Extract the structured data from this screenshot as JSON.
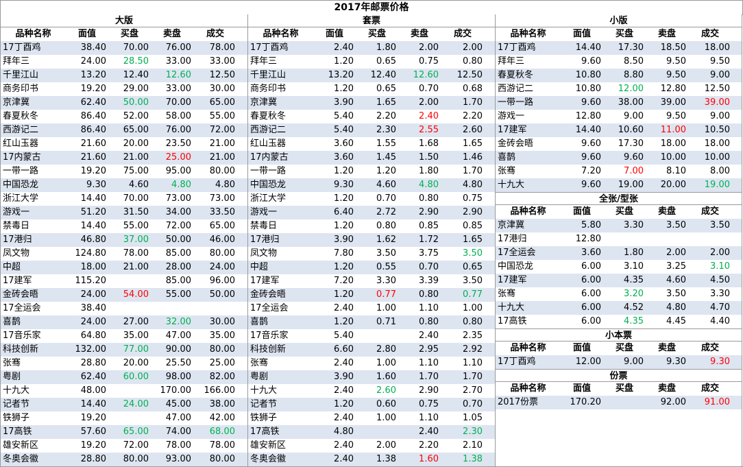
{
  "title": "2017年邮票价格",
  "colors": {
    "up": "#ff0000",
    "down": "#00b050",
    "stripe": "#dde5f1"
  },
  "columns": [
    "品种名称",
    "面值",
    "买盘",
    "卖盘",
    "成交"
  ],
  "panels": [
    {
      "title": "大版",
      "rows": [
        [
          "17丁酉鸡",
          "38.40",
          "70.00",
          "76.00",
          "78.00"
        ],
        [
          "拜年三",
          "24.00",
          "28.50",
          "33.00",
          "33.00"
        ],
        [
          "千里江山",
          "13.20",
          "12.40",
          "12.60",
          "12.50"
        ],
        [
          "商务印书",
          "19.20",
          "29.00",
          "33.00",
          "30.00"
        ],
        [
          "京津冀",
          "62.40",
          "50.00",
          "70.00",
          "65.00"
        ],
        [
          "春夏秋冬",
          "86.40",
          "52.00",
          "58.00",
          "55.00"
        ],
        [
          "西游记二",
          "86.40",
          "65.00",
          "76.00",
          "72.00"
        ],
        [
          "红山玉器",
          "21.60",
          "20.00",
          "23.50",
          "21.00"
        ],
        [
          "17内蒙古",
          "21.60",
          "21.00",
          "25.00",
          "21.00"
        ],
        [
          "一带一路",
          "19.20",
          "75.00",
          "95.00",
          "80.00"
        ],
        [
          "中国恐龙",
          "9.30",
          "4.60",
          "4.80",
          "4.80"
        ],
        [
          "浙江大学",
          "14.40",
          "70.00",
          "73.00",
          "73.00"
        ],
        [
          "游戏一",
          "51.20",
          "31.50",
          "34.00",
          "33.50"
        ],
        [
          "禁毒日",
          "14.40",
          "55.00",
          "72.00",
          "65.00"
        ],
        [
          "17港归",
          "46.80",
          "37.00",
          "50.00",
          "46.00"
        ],
        [
          "凤文物",
          "124.80",
          "78.00",
          "85.00",
          "80.00"
        ],
        [
          "中超",
          "18.00",
          "21.00",
          "28.00",
          "24.00"
        ],
        [
          "17建军",
          "115.20",
          "",
          "85.00",
          "96.00"
        ],
        [
          "金砖会晤",
          "24.00",
          "54.00",
          "55.00",
          "50.00"
        ],
        [
          "17全运会",
          "38.40",
          "",
          "",
          ""
        ],
        [
          "喜鹊",
          "24.00",
          "27.00",
          "32.00",
          "30.00"
        ],
        [
          "17音乐家",
          "64.80",
          "35.00",
          "47.00",
          "35.00"
        ],
        [
          "科技创新",
          "132.00",
          "77.00",
          "90.00",
          "80.00"
        ],
        [
          "张骞",
          "28.80",
          "20.00",
          "25.50",
          "25.00"
        ],
        [
          "粤剧",
          "62.40",
          "60.00",
          "98.00",
          "82.00"
        ],
        [
          "十九大",
          "48.00",
          "",
          "170.00",
          "166.00"
        ],
        [
          "记者节",
          "14.40",
          "24.00",
          "45.00",
          "38.00"
        ],
        [
          "铁狮子",
          "19.20",
          "",
          "47.00",
          "42.00"
        ],
        [
          "17高铁",
          "57.60",
          "65.00",
          "74.00",
          "68.00"
        ],
        [
          "雄安新区",
          "19.20",
          "72.00",
          "78.00",
          "78.00"
        ],
        [
          "冬奥会徽",
          "28.80",
          "80.00",
          "93.00",
          "80.00"
        ]
      ],
      "colors": {
        "1-2": "green",
        "2-3": "green",
        "4-2": "green",
        "8-3": "red",
        "10-3": "green",
        "14-2": "green",
        "18-2": "red",
        "20-3": "green",
        "22-2": "green",
        "24-2": "green",
        "26-2": "green",
        "28-2": "green",
        "28-4": "green"
      }
    },
    {
      "title": "套票",
      "rows": [
        [
          "17丁酉鸡",
          "2.40",
          "1.80",
          "2.00",
          "2.00"
        ],
        [
          "拜年三",
          "1.20",
          "0.65",
          "0.75",
          "0.80"
        ],
        [
          "千里江山",
          "13.20",
          "12.40",
          "12.60",
          "12.50"
        ],
        [
          "商务印书",
          "1.20",
          "0.65",
          "0.70",
          "0.68"
        ],
        [
          "京津冀",
          "3.90",
          "1.65",
          "2.00",
          "1.70"
        ],
        [
          "春夏秋冬",
          "5.40",
          "2.20",
          "2.40",
          "2.20"
        ],
        [
          "西游记二",
          "5.40",
          "2.30",
          "2.55",
          "2.60"
        ],
        [
          "红山玉器",
          "3.60",
          "1.55",
          "1.68",
          "1.65"
        ],
        [
          "17内蒙古",
          "3.60",
          "1.45",
          "1.50",
          "1.46"
        ],
        [
          "一带一路",
          "1.20",
          "1.20",
          "1.80",
          "1.70"
        ],
        [
          "中国恐龙",
          "9.30",
          "4.60",
          "4.80",
          "4.80"
        ],
        [
          "浙江大学",
          "1.20",
          "0.70",
          "0.80",
          "0.75"
        ],
        [
          "游戏一",
          "6.40",
          "2.72",
          "2.90",
          "2.90"
        ],
        [
          "禁毒日",
          "1.20",
          "0.80",
          "0.85",
          "0.85"
        ],
        [
          "17港归",
          "3.90",
          "1.62",
          "1.72",
          "1.65"
        ],
        [
          "凤文物",
          "7.80",
          "3.50",
          "3.75",
          "3.50"
        ],
        [
          "中超",
          "1.20",
          "0.55",
          "0.70",
          "0.65"
        ],
        [
          "17建军",
          "7.20",
          "3.30",
          "3.39",
          "3.50"
        ],
        [
          "金砖会晤",
          "1.20",
          "0.77",
          "0.80",
          "0.77"
        ],
        [
          "17全运会",
          "2.40",
          "1.00",
          "1.10",
          "1.00"
        ],
        [
          "喜鹊",
          "1.20",
          "0.71",
          "0.80",
          "0.80"
        ],
        [
          "17音乐家",
          "5.40",
          "",
          "2.40",
          "2.35"
        ],
        [
          "科技创新",
          "6.60",
          "2.80",
          "2.95",
          "2.92"
        ],
        [
          "张骞",
          "2.40",
          "1.00",
          "1.10",
          "1.10"
        ],
        [
          "粤剧",
          "3.90",
          "1.60",
          "1.70",
          "1.70"
        ],
        [
          "十九大",
          "2.40",
          "2.60",
          "2.90",
          "2.70"
        ],
        [
          "记者节",
          "1.20",
          "0.60",
          "0.75",
          "0.70"
        ],
        [
          "铁狮子",
          "2.40",
          "1.00",
          "1.10",
          "1.05"
        ],
        [
          "17高铁",
          "4.80",
          "",
          "2.40",
          "2.30"
        ],
        [
          "雄安新区",
          "2.40",
          "2.00",
          "2.20",
          "2.10"
        ],
        [
          "冬奥会徽",
          "2.40",
          "1.38",
          "1.60",
          "1.38"
        ]
      ],
      "colors": {
        "2-3": "green",
        "5-3": "red",
        "6-3": "red",
        "10-3": "green",
        "15-4": "green",
        "18-2": "red",
        "18-4": "green",
        "25-2": "green",
        "28-4": "green",
        "30-3": "red",
        "30-4": "green"
      }
    }
  ],
  "right": {
    "xiaoban": {
      "title": "小版",
      "rows": [
        [
          "17丁酉鸡",
          "14.40",
          "17.30",
          "18.50",
          "18.00"
        ],
        [
          "拜年三",
          "9.60",
          "8.50",
          "9.50",
          "9.50"
        ],
        [
          "春夏秋冬",
          "10.80",
          "8.80",
          "9.50",
          "9.00"
        ],
        [
          "西游记二",
          "10.80",
          "12.00",
          "12.80",
          "12.50"
        ],
        [
          "一带一路",
          "9.60",
          "38.00",
          "39.00",
          "39.00"
        ],
        [
          "游戏一",
          "12.80",
          "9.00",
          "9.50",
          "9.00"
        ],
        [
          "17建军",
          "14.40",
          "10.60",
          "11.00",
          "10.50"
        ],
        [
          "金砖会晤",
          "9.60",
          "17.30",
          "18.00",
          "18.00"
        ],
        [
          "喜鹊",
          "9.60",
          "9.60",
          "10.00",
          "10.00"
        ],
        [
          "张骞",
          "7.20",
          "7.00",
          "8.10",
          "8.00"
        ],
        [
          "十九大",
          "9.60",
          "19.00",
          "20.00",
          "19.00"
        ]
      ],
      "colors": {
        "3-2": "green",
        "4-4": "red",
        "6-3": "red",
        "9-2": "red",
        "10-4": "green"
      }
    },
    "quanzhang": {
      "title": "全张/型张",
      "rows": [
        [
          "京津冀",
          "5.80",
          "3.30",
          "3.50",
          "3.50"
        ],
        [
          "17港归",
          "12.80",
          "",
          "",
          ""
        ],
        [
          "17全运会",
          "3.60",
          "1.80",
          "2.00",
          "2.00"
        ],
        [
          "中国恐龙",
          "6.00",
          "3.10",
          "3.25",
          "3.10"
        ],
        [
          "17建军",
          "6.00",
          "4.35",
          "4.60",
          "4.50"
        ],
        [
          "张骞",
          "6.00",
          "3.20",
          "3.50",
          "3.30"
        ],
        [
          "十九大",
          "6.00",
          "4.52",
          "4.80",
          "4.70"
        ],
        [
          "17高铁",
          "6.00",
          "4.35",
          "4.45",
          "4.40"
        ]
      ],
      "colors": {
        "3-4": "green",
        "5-2": "green",
        "7-2": "green"
      }
    },
    "xiaobenpiao": {
      "title": "小本票",
      "rows": [
        [
          "17丁酉鸡",
          "12.00",
          "9.00",
          "9.30",
          "9.30"
        ]
      ],
      "colors": {
        "0-4": "red"
      }
    },
    "fenpiao": {
      "title": "份票",
      "rows": [
        [
          "2017份票",
          "170.20",
          "",
          "92.00",
          "91.00"
        ]
      ],
      "colors": {
        "0-4": "red"
      }
    }
  }
}
